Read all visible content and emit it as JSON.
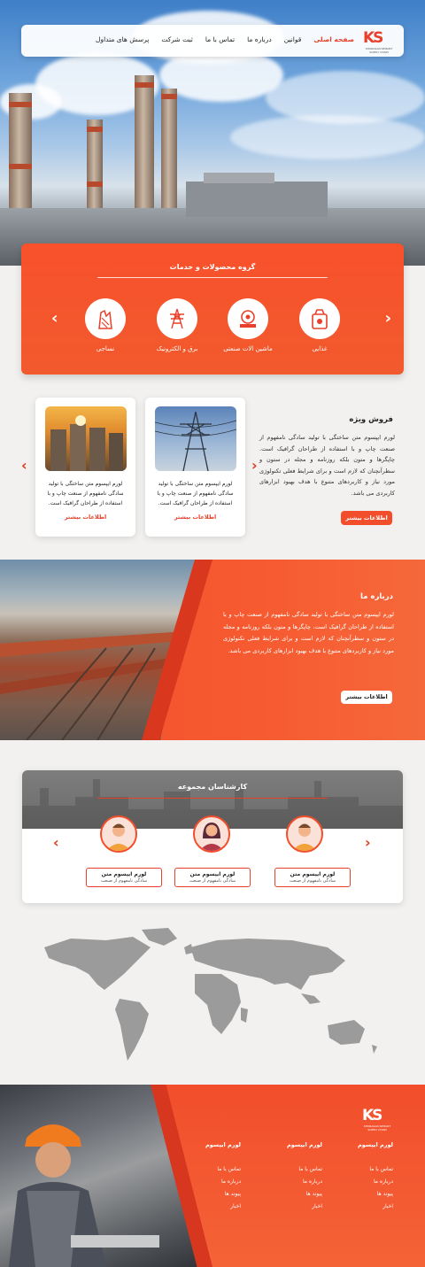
{
  "header": {
    "logo": {
      "mark": "KS",
      "sub": "KHORASAN SEMANT SUPPLY CHAIN"
    },
    "nav": [
      {
        "label": "صفحه اصلی",
        "active": true
      },
      {
        "label": "قوانین"
      },
      {
        "label": "درباره ما"
      },
      {
        "label": "تماس با ما"
      },
      {
        "label": "ثبت شرکت"
      },
      {
        "label": "پرسش های متداول"
      }
    ]
  },
  "products": {
    "title": "گروه محصولات و خدمات",
    "items": [
      {
        "label": "غذایی",
        "icon": "food-bag-icon"
      },
      {
        "label": "ماشین الات صنعتی",
        "icon": "machine-icon"
      },
      {
        "label": "برق و الکترونیک",
        "icon": "power-tower-icon"
      },
      {
        "label": "نساجی",
        "icon": "textile-icon"
      }
    ]
  },
  "special_sale": {
    "title": "فروش ویژه",
    "text": "لورم ایپسوم متن ساختگی با تولید سادگی نامفهوم از صنعت چاپ و با استفاده از طراحان گرافیک است. چاپگرها و متون بلکه روزنامه و مجله در ستون و سطرآنچنان که لازم است و برای شرایط فعلی تکنولوژی مورد نیاز و کاربردهای متنوع با هدف بهبود ابزارهای کاربردی می باشد.",
    "button": "اطلاعات بیشتر",
    "cards": [
      {
        "text": "لورم ایپسوم متن ساختگی با تولید سادگی نامفهوم از صنعت چاپ و با استفاده از طراحان گرافیک است.",
        "button": "اطلاعات بیشتر",
        "image": "power-lines"
      },
      {
        "text": "لورم ایپسوم متن ساختگی با تولید سادگی نامفهوم از صنعت چاپ و با استفاده از طراحان گرافیک است.",
        "button": "اطلاعات بیشتر",
        "image": "silos-sunset"
      }
    ]
  },
  "about": {
    "title": "درباره ما",
    "text": "لورم ایپسوم متن ساختگی با تولید سادگی نامفهوم از صنعت چاپ و با استفاده از طراحان گرافیک است، چاپگرها و متون بلکه روزنامه و مجله در ستون و سطرآنچنان که لازم است و برای شرایط فعلی تکنولوژی مورد نیاز و کاربردهای متنوع با هدف بهبود ابزارهای کاربردی می باشد.",
    "button": "اطلاعات بیشتر"
  },
  "experts": {
    "title": "کارشناسان مجموعه",
    "people": [
      {
        "name": "لورم ایپسوم متن",
        "role": "سادگی نامفهوم از صنعت",
        "gender": "male"
      },
      {
        "name": "لورم ایپسوم متن",
        "role": "سادگی نامفهوم از صنعت",
        "gender": "female"
      },
      {
        "name": "لورم ایپسوم متن",
        "role": "سادگی نامفهوم از صنعت",
        "gender": "male"
      }
    ]
  },
  "footer": {
    "logo": {
      "mark": "KS",
      "sub": "KHORASAN SEMANT SUPPLY CHAIN"
    },
    "columns": [
      {
        "title": "لورم ایپسوم",
        "links": [
          "تماس با ما",
          "درباره ما",
          "پیوند ها",
          "اخبار"
        ]
      },
      {
        "title": "لورم ایپسوم",
        "links": [
          "تماس با ما",
          "درباره ما",
          "پیوند ها",
          "اخبار"
        ]
      },
      {
        "title": "لورم ایپسوم",
        "links": [
          "تماس با ما",
          "درباره ما",
          "پیوند ها",
          "اخبار"
        ]
      }
    ]
  },
  "colors": {
    "accent": "#f24e2c",
    "dark_accent": "#d7371f",
    "gray_header": "#737373"
  }
}
